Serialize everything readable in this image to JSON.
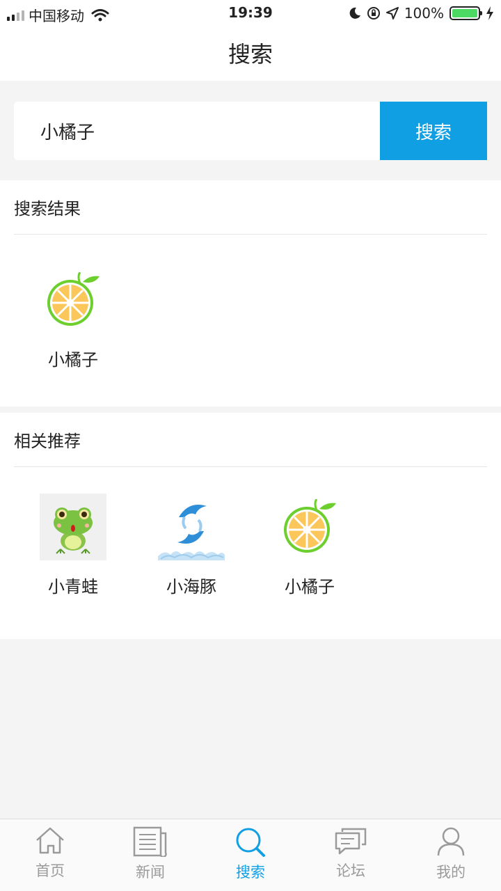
{
  "status_bar": {
    "carrier": "中国移动",
    "time": "19:39",
    "battery": "100%",
    "battery_level": 1.0
  },
  "nav": {
    "title": "搜索"
  },
  "search": {
    "value": "小橘子",
    "placeholder": "",
    "button_label": "搜索"
  },
  "results": {
    "title": "搜索结果",
    "items": [
      {
        "label": "小橘子",
        "icon": "orange-icon"
      }
    ]
  },
  "recommend": {
    "title": "相关推荐",
    "items": [
      {
        "label": "小青蛙",
        "icon": "frog-icon"
      },
      {
        "label": "小海豚",
        "icon": "dolphin-icon"
      },
      {
        "label": "小橘子",
        "icon": "orange-icon"
      }
    ]
  },
  "tabbar": {
    "active_color": "#119fe4",
    "items": [
      {
        "label": "首页",
        "icon": "home-icon"
      },
      {
        "label": "新闻",
        "icon": "news-icon"
      },
      {
        "label": "搜索",
        "icon": "search-icon"
      },
      {
        "label": "论坛",
        "icon": "forum-icon"
      },
      {
        "label": "我的",
        "icon": "profile-icon"
      }
    ]
  }
}
